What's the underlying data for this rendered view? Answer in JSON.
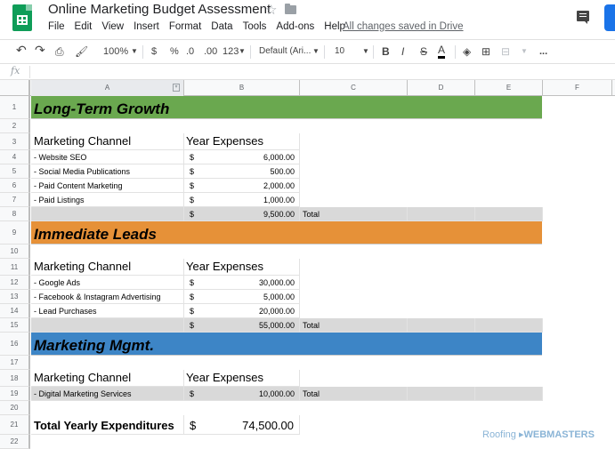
{
  "app": {
    "title": "Online Marketing Budget Assessment",
    "saved_status": "All changes saved in Drive",
    "menus": [
      "File",
      "Edit",
      "View",
      "Insert",
      "Format",
      "Data",
      "Tools",
      "Add-ons",
      "Help"
    ]
  },
  "toolbar": {
    "zoom": "100%",
    "currency": "$",
    "percent": "%",
    "dec_decrease": ".0",
    "dec_increase": ".00",
    "format_more": "123",
    "font": "Default (Ari...",
    "font_size": "10",
    "bold": "B",
    "italic": "I",
    "strike": "S",
    "text_color": "A",
    "more": "..."
  },
  "formula_bar": {
    "icon": "fx",
    "value": ""
  },
  "columns": [
    "A",
    "B",
    "C",
    "D",
    "E",
    "F"
  ],
  "rows": [
    "1",
    "2",
    "3",
    "4",
    "5",
    "6",
    "7",
    "8",
    "9",
    "10",
    "11",
    "12",
    "13",
    "14",
    "15",
    "16",
    "17",
    "18",
    "19",
    "20",
    "21",
    "22"
  ],
  "sections": {
    "long_term": {
      "title": "Long-Term Growth",
      "channel_header": "Marketing Channel",
      "expense_header": "Year Expenses",
      "items": [
        {
          "name": "- Website SEO",
          "cur": "$",
          "amount": "6,000.00"
        },
        {
          "name": "- Social Media Publications",
          "cur": "$",
          "amount": "500.00"
        },
        {
          "name": "- Paid Content Marketing",
          "cur": "$",
          "amount": "2,000.00"
        },
        {
          "name": "- Paid Listings",
          "cur": "$",
          "amount": "1,000.00"
        }
      ],
      "total": {
        "cur": "$",
        "amount": "9,500.00",
        "label": "Total"
      }
    },
    "immediate": {
      "title": "Immediate Leads",
      "channel_header": "Marketing Channel",
      "expense_header": "Year Expenses",
      "items": [
        {
          "name": "- Google Ads",
          "cur": "$",
          "amount": "30,000.00"
        },
        {
          "name": "- Facebook & Instagram Advertising",
          "cur": "$",
          "amount": "5,000.00"
        },
        {
          "name": "- Lead Purchases",
          "cur": "$",
          "amount": "20,000.00"
        }
      ],
      "total": {
        "cur": "$",
        "amount": "55,000.00",
        "label": "Total"
      }
    },
    "mgmt": {
      "title": "Marketing Mgmt.",
      "channel_header": "Marketing Channel",
      "expense_header": "Year Expenses",
      "items": [
        {
          "name": "- Digital Marketing Services",
          "cur": "$",
          "amount": "10,000.00",
          "label": "Total"
        }
      ]
    }
  },
  "grand_total": {
    "label": "Total Yearly Expenditures",
    "cur": "$",
    "amount": "74,500.00"
  },
  "watermark": {
    "part1": "Roofing",
    "part2": "WEBMASTERS"
  },
  "colors": {
    "green": "#6aa84f",
    "orange": "#e69138",
    "blue": "#3d85c6",
    "grey": "#d9d9d9"
  }
}
